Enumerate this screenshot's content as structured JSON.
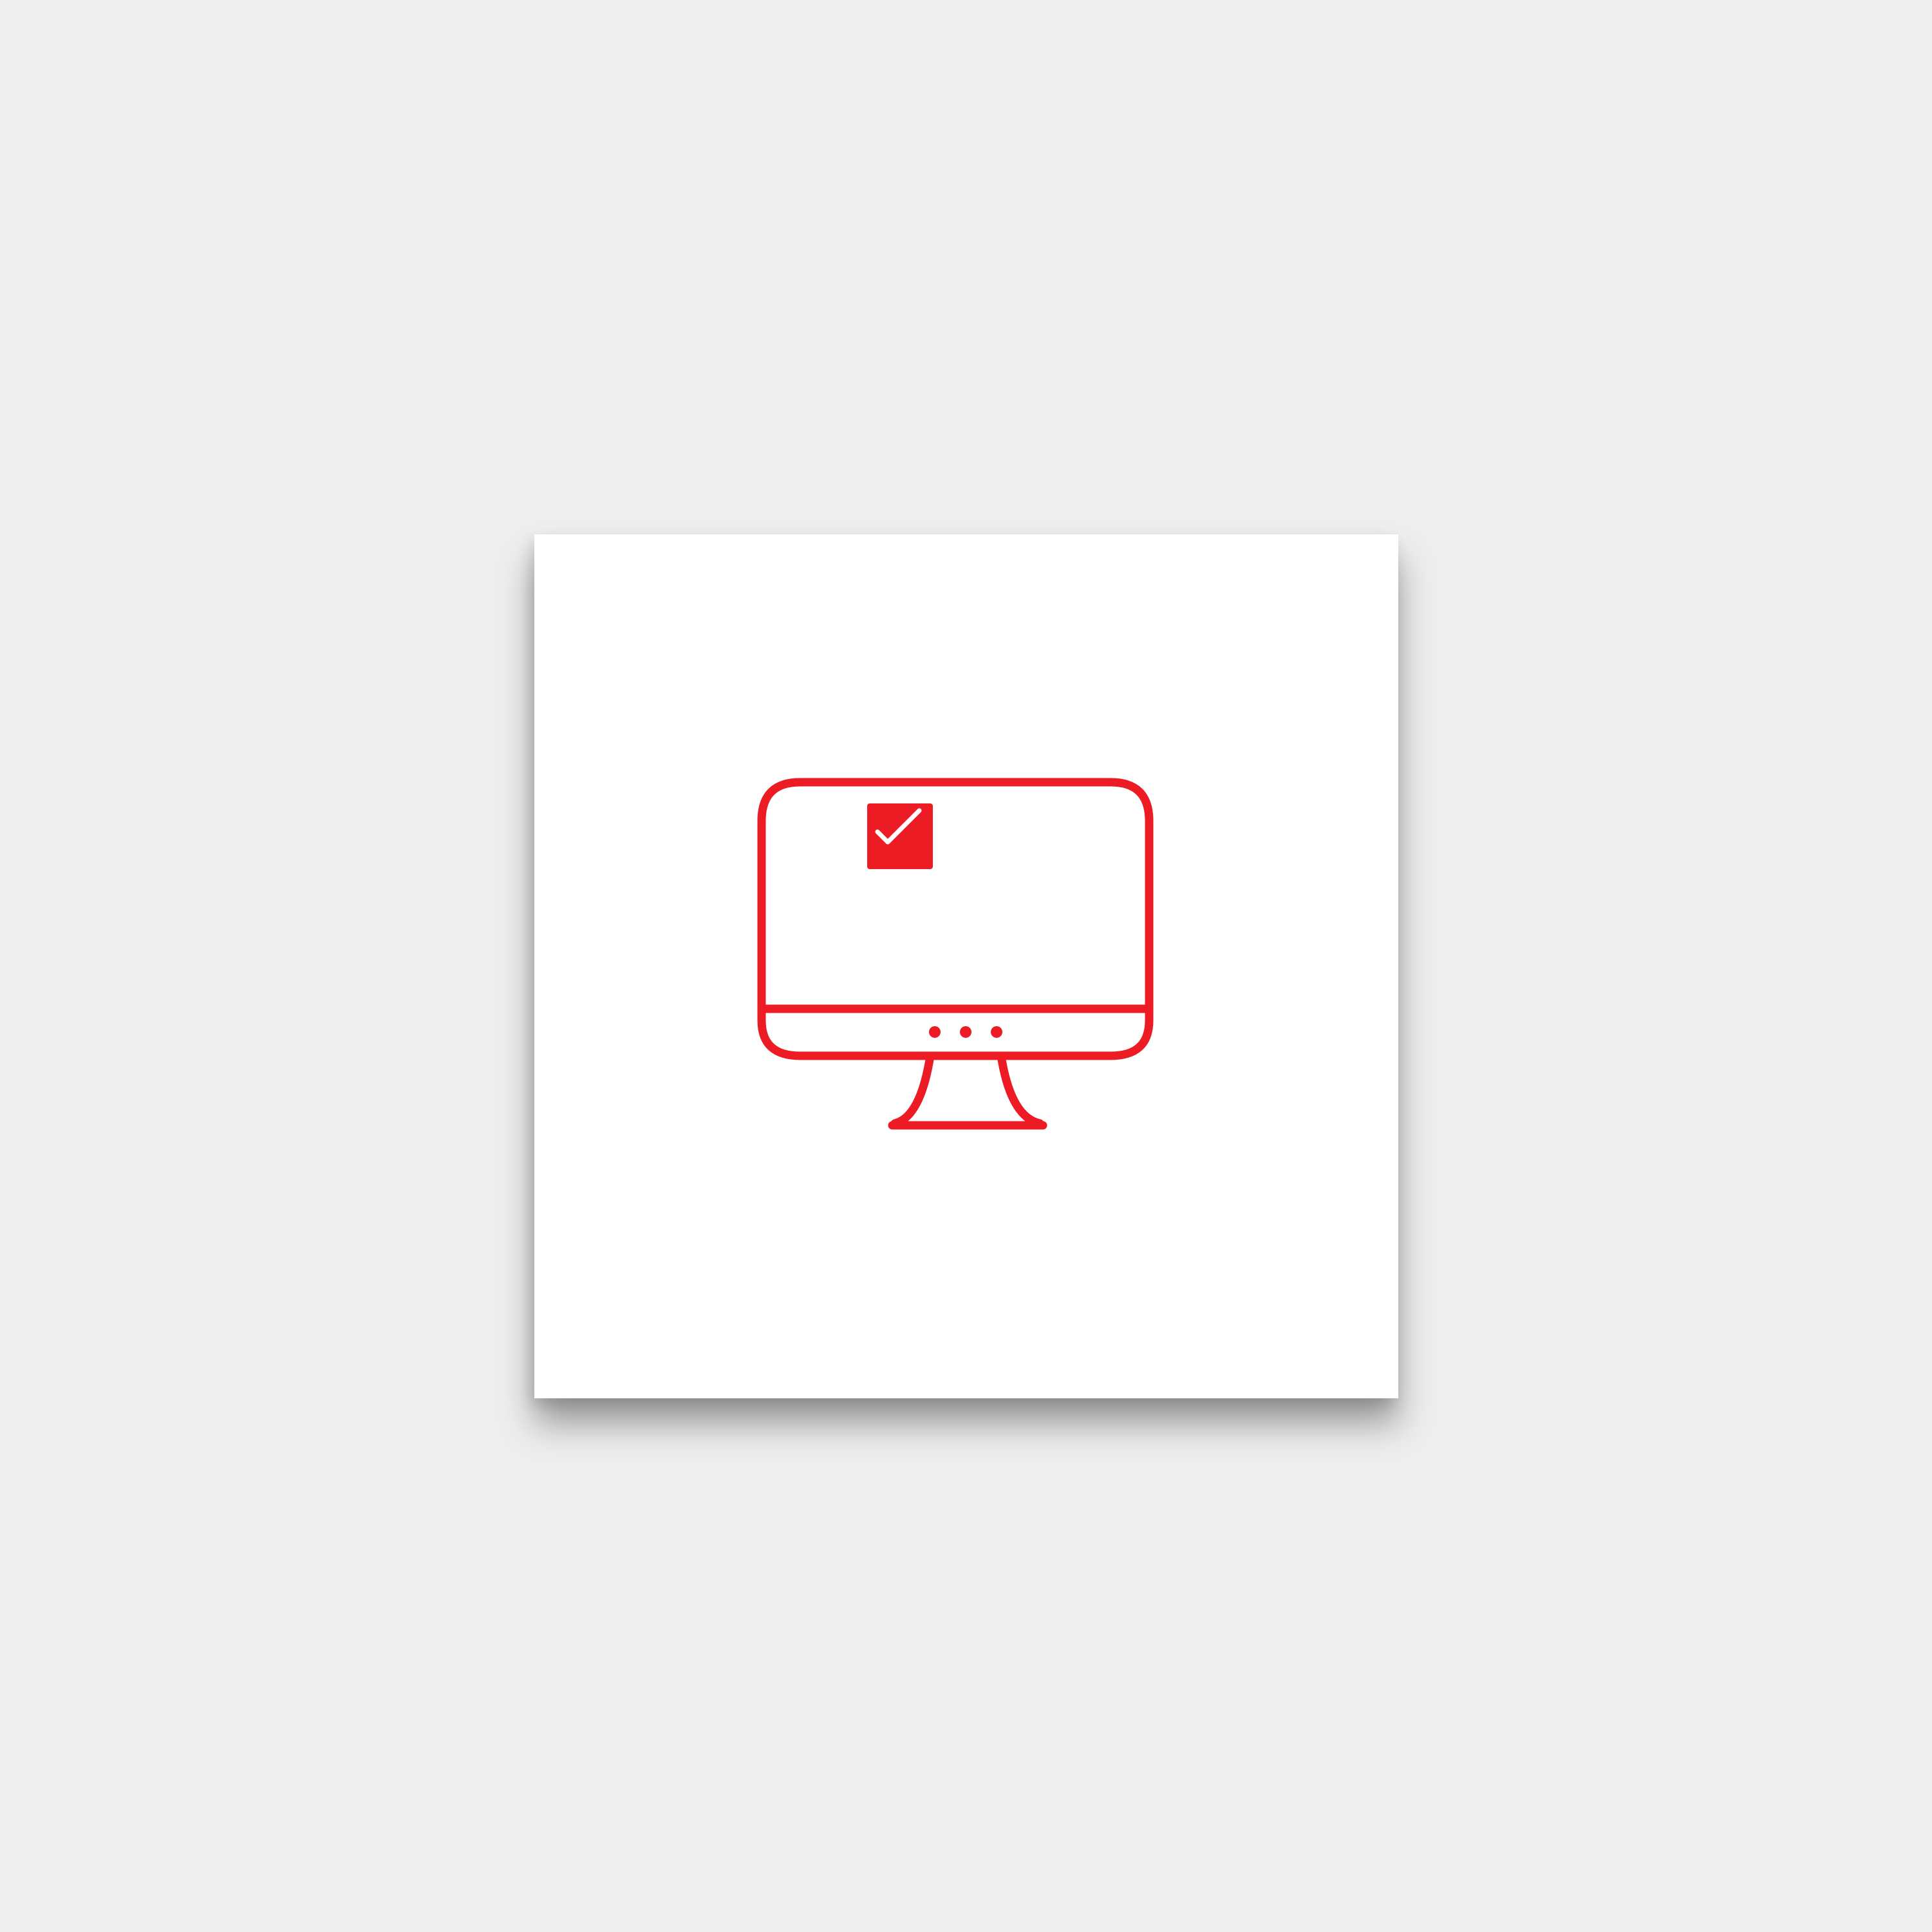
{
  "colors": {
    "background": "#eeeeee",
    "card": "#ffffff",
    "accent": "#ed1c24",
    "check": "#ffffff"
  },
  "icon": {
    "name": "monitor-check-icon",
    "indicator_dots": 3
  }
}
